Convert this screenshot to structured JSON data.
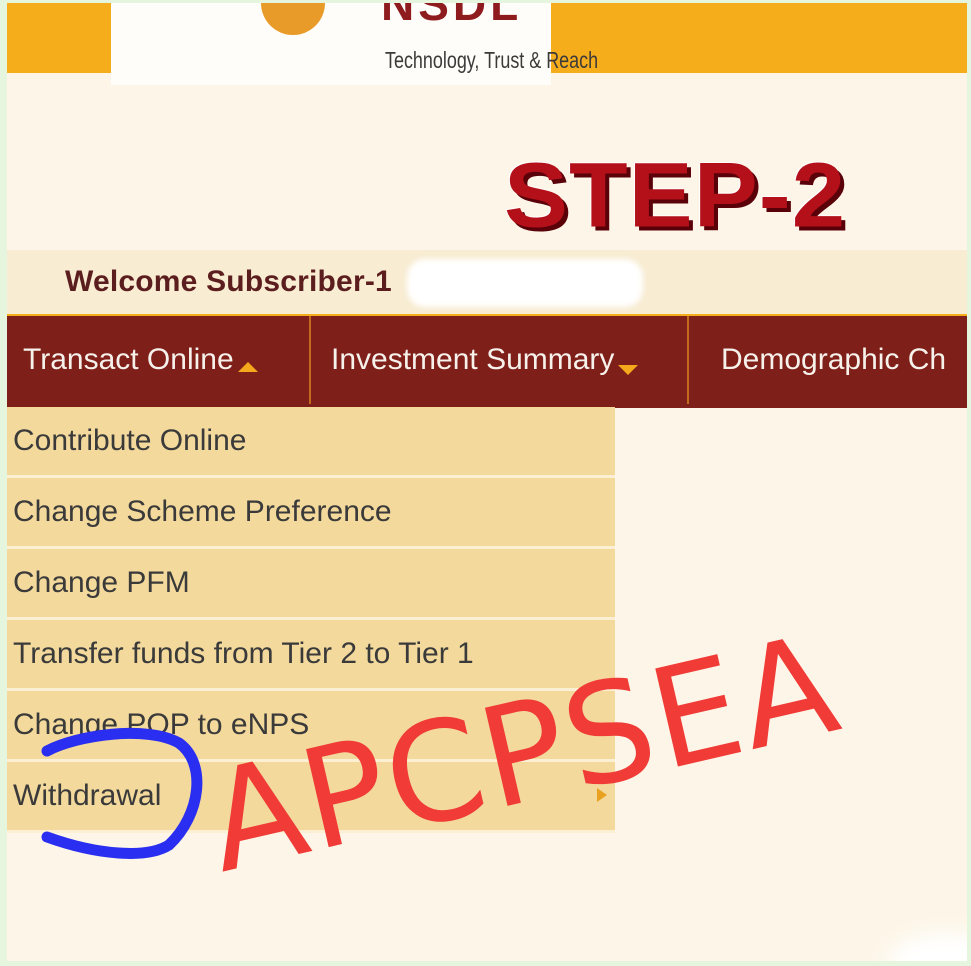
{
  "header": {
    "logo_letters": "NSDL",
    "tagline": "Technology, Trust & Reach"
  },
  "step_label": "STEP-2",
  "welcome": {
    "text": "Welcome Subscriber-1"
  },
  "nav": {
    "items": [
      {
        "label": "Transact Online",
        "caret": "up"
      },
      {
        "label": "Investment Summary",
        "caret": "down"
      },
      {
        "label": "Demographic Ch",
        "caret": ""
      }
    ]
  },
  "dropdown": {
    "items": [
      {
        "label": "Contribute Online"
      },
      {
        "label": "Change Scheme Preference"
      },
      {
        "label": "Change PFM"
      },
      {
        "label": "Transfer funds from Tier 2 to Tier 1"
      },
      {
        "label": "Change POP to eNPS"
      },
      {
        "label": "Withdrawal"
      }
    ]
  },
  "watermark": "APCPSEA",
  "colors": {
    "brand_orange": "#f5ad1b",
    "nav_maroon": "#7f1f19",
    "menu_beige": "#f3d99c",
    "step_red": "#b3101a",
    "watermark_red": "#f03b37",
    "annotation_blue": "#2a2ef0"
  }
}
